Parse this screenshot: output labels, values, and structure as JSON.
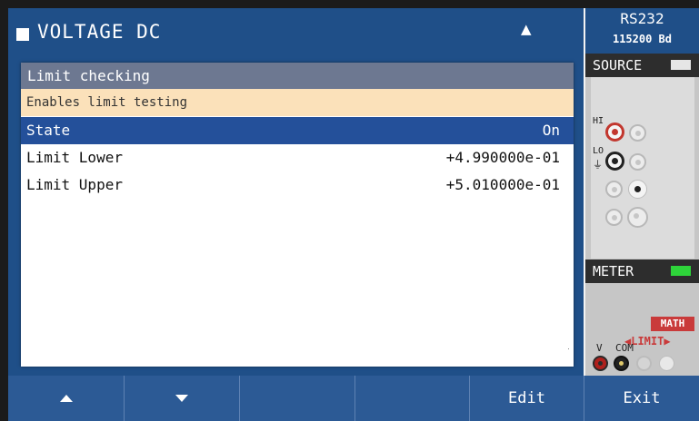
{
  "header": {
    "title": "VOLTAGE DC",
    "warning_symbol": "▲",
    "interface": "RS232",
    "baud": "115200 Bd"
  },
  "dialog": {
    "title": "Limit checking",
    "description": "Enables limit testing",
    "rows": [
      {
        "label": "State",
        "value": "On",
        "selected": true
      },
      {
        "label": "Limit Lower",
        "value": "+4.990000e-01",
        "selected": false
      },
      {
        "label": "Limit Upper",
        "value": "+5.010000e-01",
        "selected": false
      }
    ]
  },
  "side": {
    "source_label": "SOURCE",
    "hi_label": "HI",
    "lo_label": "LO",
    "meter_label": "METER",
    "math_label": "MATH",
    "limit_label": "◀LIMIT▶",
    "v_label": "V",
    "com_label": "COM"
  },
  "softkeys": [
    "",
    "",
    "",
    "",
    "Edit",
    "Exit"
  ],
  "colors": {
    "header_bg": "#1f4f88",
    "selected_row": "#24509a",
    "dialog_title_bg": "#6d7891",
    "description_bg": "#fbe1ba",
    "softkey_bg": "#2c5a95",
    "meter_indicator": "#2ed43a",
    "math_red": "#c93a3a"
  }
}
